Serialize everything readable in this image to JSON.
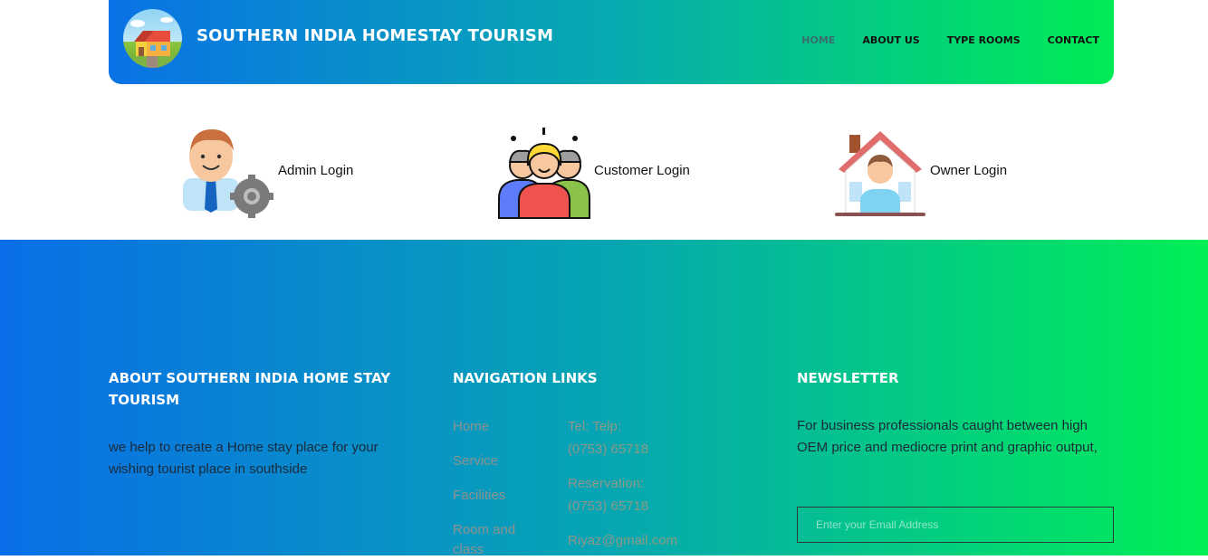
{
  "header": {
    "site_title": "SOUTHERN INDIA HOMESTAY TOURISM",
    "nav": [
      "HOME",
      "ABOUT US",
      "TYPE ROOMS",
      "CONTACT"
    ],
    "active_nav": "HOME"
  },
  "logins": [
    {
      "label": "Admin Login",
      "icon": "admin-icon"
    },
    {
      "label": "Customer Login",
      "icon": "customers-icon"
    },
    {
      "label": "Owner Login",
      "icon": "owner-house-icon"
    }
  ],
  "footer": {
    "about": {
      "title": "ABOUT SOUTHERN INDIA HOME STAY TOURISM",
      "text": "we help to create a Home stay place for your wishing tourist place in southside"
    },
    "navigation": {
      "title": "NAVIGATION LINKS",
      "links": [
        "Home",
        "Service",
        "Facilities",
        "Room and class"
      ],
      "contact": [
        "Tel: Telp:",
        "(0753) 65718",
        "Reservation:",
        "(0753) 65718",
        "Riyaz@gmail.com"
      ]
    },
    "newsletter": {
      "title": "NEWSLETTER",
      "text": "For business professionals caught between high OEM price and mediocre print and graphic output,",
      "placeholder": "Enter your Email Address"
    }
  },
  "colors": {
    "gradient_start": "#0a72e6",
    "gradient_end": "#00ec55"
  }
}
